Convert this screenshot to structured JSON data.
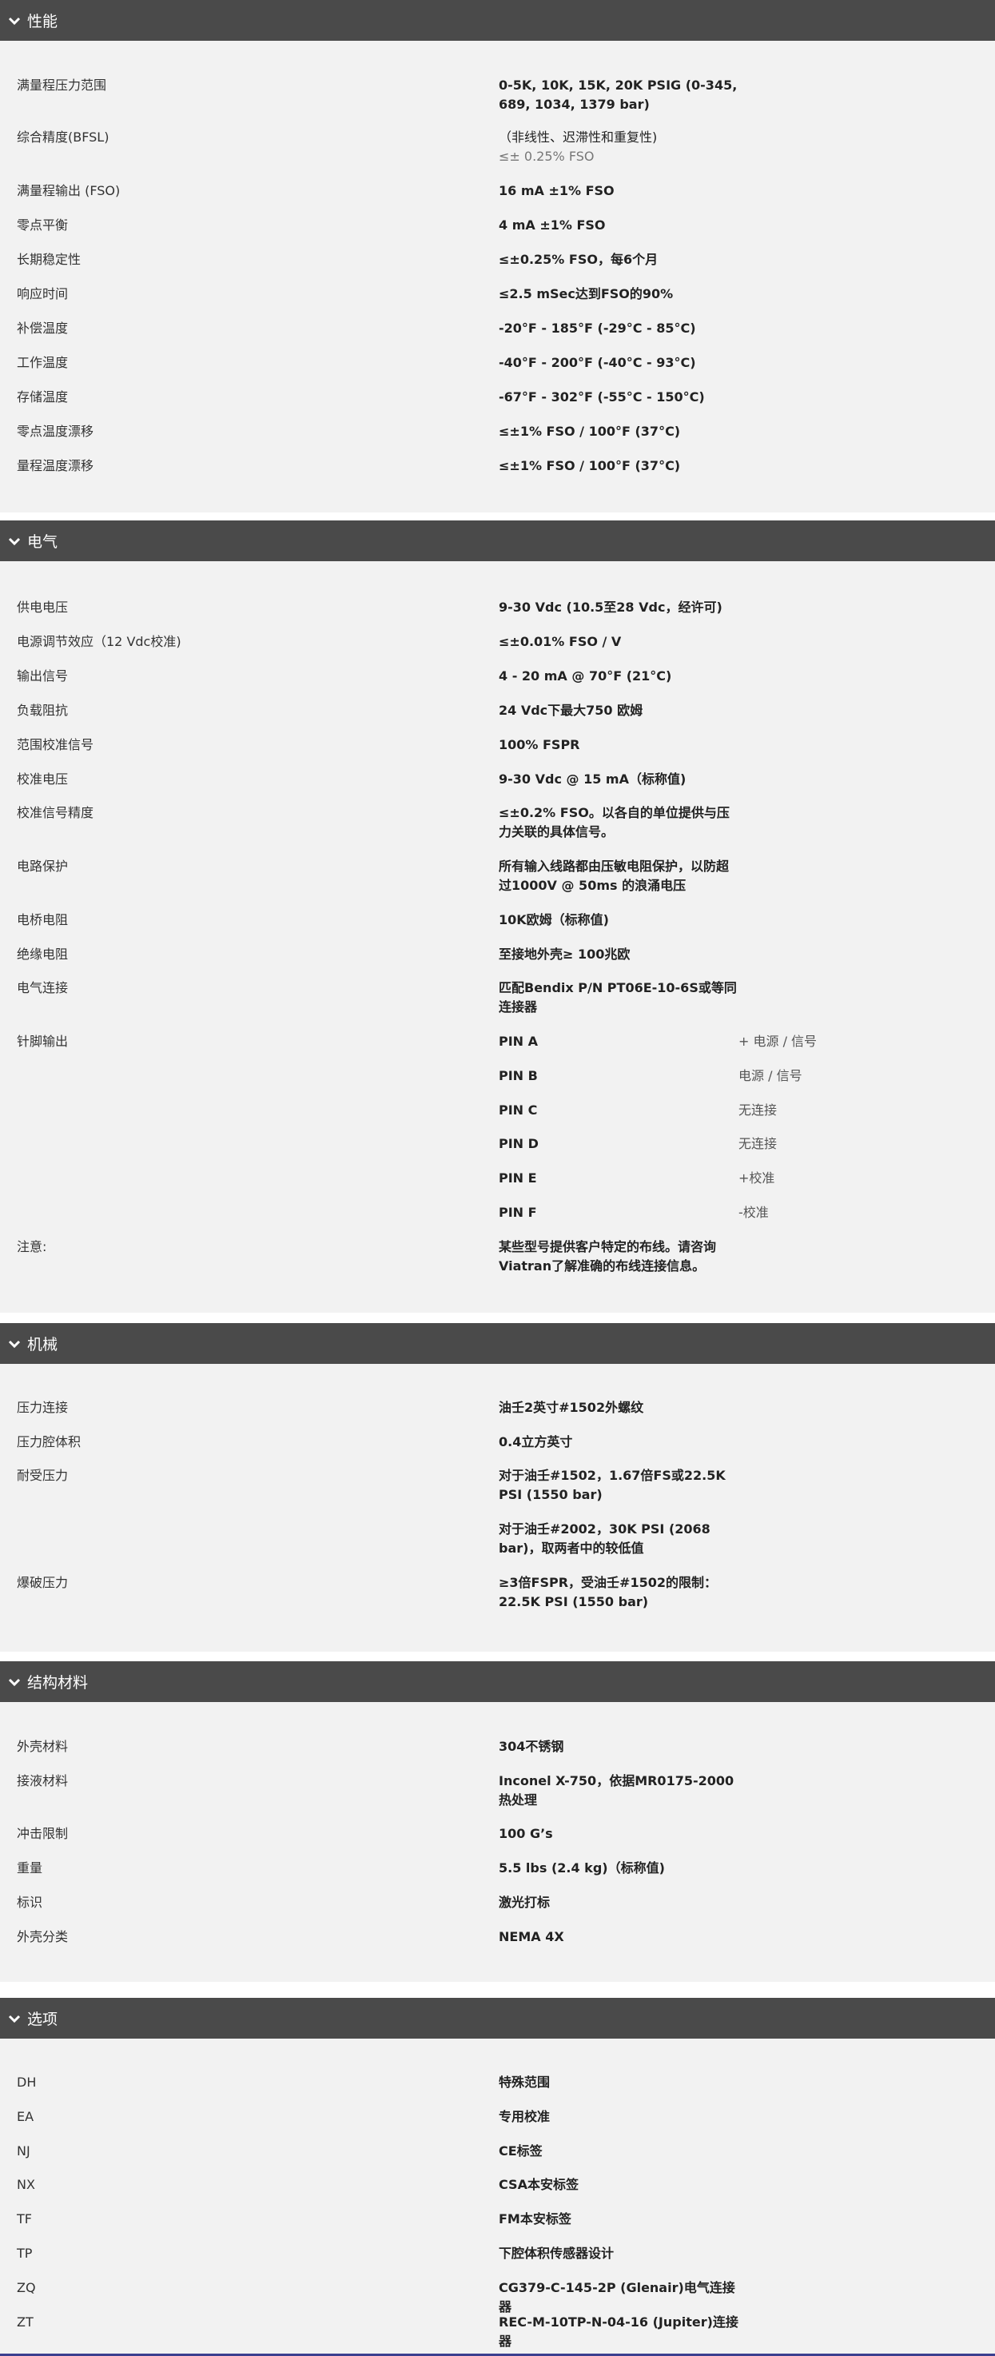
{
  "sections": [
    {
      "title": "性能",
      "rows": [
        {
          "label": "满量程压力范围",
          "value": "0-5K, 10K, 15K, 20K PSIG (0-345, 689, 1034, 1379 bar)"
        },
        {
          "label": "综合精度(BFSL)",
          "value": "（非线性、迟滞性和重复性)",
          "sub": "≤± 0.25% FSO"
        },
        {
          "label": "满量程输出 (FSO)",
          "value": "16 mA ±1% FSO"
        },
        {
          "label": "零点平衡",
          "value": "4 mA ±1% FSO"
        },
        {
          "label": "长期稳定性",
          "value": "≤±0.25% FSO，每6个月"
        },
        {
          "label": "响应时间",
          "value": "≤2.5 mSec达到FSO的90%"
        },
        {
          "label": "补偿温度",
          "value": "-20°F - 185°F (-29°C - 85°C)"
        },
        {
          "label": "工作温度",
          "value": "-40°F - 200°F (-40°C - 93°C)"
        },
        {
          "label": "存储温度",
          "value": "-67°F - 302°F (-55°C - 150°C)"
        },
        {
          "label": "零点温度漂移",
          "value": "≤±1% FSO / 100°F (37°C)"
        },
        {
          "label": "量程温度漂移",
          "value": "≤±1% FSO / 100°F (37°C)"
        }
      ]
    },
    {
      "title": "电气",
      "rows": [
        {
          "label": "供电电压",
          "value": "9-30 Vdc (10.5至28 Vdc，经许可)"
        },
        {
          "label": "电源调节效应（12 Vdc校准)",
          "value": "≤±0.01% FSO / V"
        },
        {
          "label": "输出信号",
          "value": "4 - 20 mA @ 70°F (21°C)"
        },
        {
          "label": "负载阻抗",
          "value": "24 Vdc下最大750 欧姆"
        },
        {
          "label": "范围校准信号",
          "value": "100% FSPR"
        },
        {
          "label": "校准电压",
          "value": "9-30 Vdc @ 15 mA（标称值)"
        },
        {
          "label": "校准信号精度",
          "value": "≤±0.2% FSO。以各自的单位提供与压力关联的具体信号。"
        },
        {
          "label": "电路保护",
          "value": "所有输入线路都由压敏电阻保护，以防超过1000V @ 50ms 的浪涌电压"
        },
        {
          "label": "电桥电阻",
          "value": "10K欧姆（标称值)"
        },
        {
          "label": "绝缘电阻",
          "value": "至接地外壳≥ 100兆欧"
        },
        {
          "label": "电气连接",
          "value": "匹配Bendix P/N PT06E-10-6S或等同连接器"
        },
        {
          "label": "针脚输出",
          "value": ""
        },
        {
          "label": "注意:",
          "value": "某些型号提供客户特定的布线。请咨询Viatran了解准确的布线连接信息。"
        }
      ],
      "pins": [
        {
          "pin": "PIN A",
          "desc": "+ 电源 / 信号"
        },
        {
          "pin": "PIN B",
          "desc": "电源 / 信号"
        },
        {
          "pin": "PIN C",
          "desc": "无连接"
        },
        {
          "pin": "PIN D",
          "desc": "无连接"
        },
        {
          "pin": "PIN E",
          "desc": "+校准"
        },
        {
          "pin": "PIN F",
          "desc": "-校准"
        }
      ]
    },
    {
      "title": "机械",
      "rows": [
        {
          "label": "压力连接",
          "value": "油壬2英寸#1502外螺纹"
        },
        {
          "label": "压力腔体积",
          "value": "0.4立方英寸"
        },
        {
          "label": "耐受压力",
          "value": "对于油壬#1502，1.67倍FS或22.5K PSI (1550 bar)",
          "value2": "对于油壬#2002，30K PSI (2068 bar)，取两者中的较低值"
        },
        {
          "label": "爆破压力",
          "value": "≥3倍FSPR，受油壬#1502的限制：22.5K PSI (1550 bar)"
        }
      ]
    },
    {
      "title": "结构材料",
      "rows": [
        {
          "label": "外壳材料",
          "value": "304不锈钢"
        },
        {
          "label": "接液材料",
          "value": "Inconel X-750，依据MR0175-2000热处理"
        },
        {
          "label": "冲击限制",
          "value": "100 G’s"
        },
        {
          "label": "重量",
          "value": "5.5 lbs (2.4 kg)（标称值)"
        },
        {
          "label": "标识",
          "value": "激光打标"
        },
        {
          "label": "外壳分类",
          "value": "NEMA 4X"
        }
      ]
    },
    {
      "title": "选项",
      "rows": [
        {
          "label": "DH",
          "value": "特殊范围"
        },
        {
          "label": "EA",
          "value": "专用校准"
        },
        {
          "label": "NJ",
          "value": "CE标签"
        },
        {
          "label": "NX",
          "value": "CSA本安标签"
        },
        {
          "label": "TF",
          "value": "FM本安标签"
        },
        {
          "label": "TP",
          "value": "下腔体积传感器设计"
        },
        {
          "label": "ZQ",
          "value": "CG379-C-145-2P (Glenair)电气连接器"
        },
        {
          "label": "ZT",
          "value": "REC-M-10TP-N-04-16 (Jupiter)连接器"
        }
      ]
    }
  ]
}
